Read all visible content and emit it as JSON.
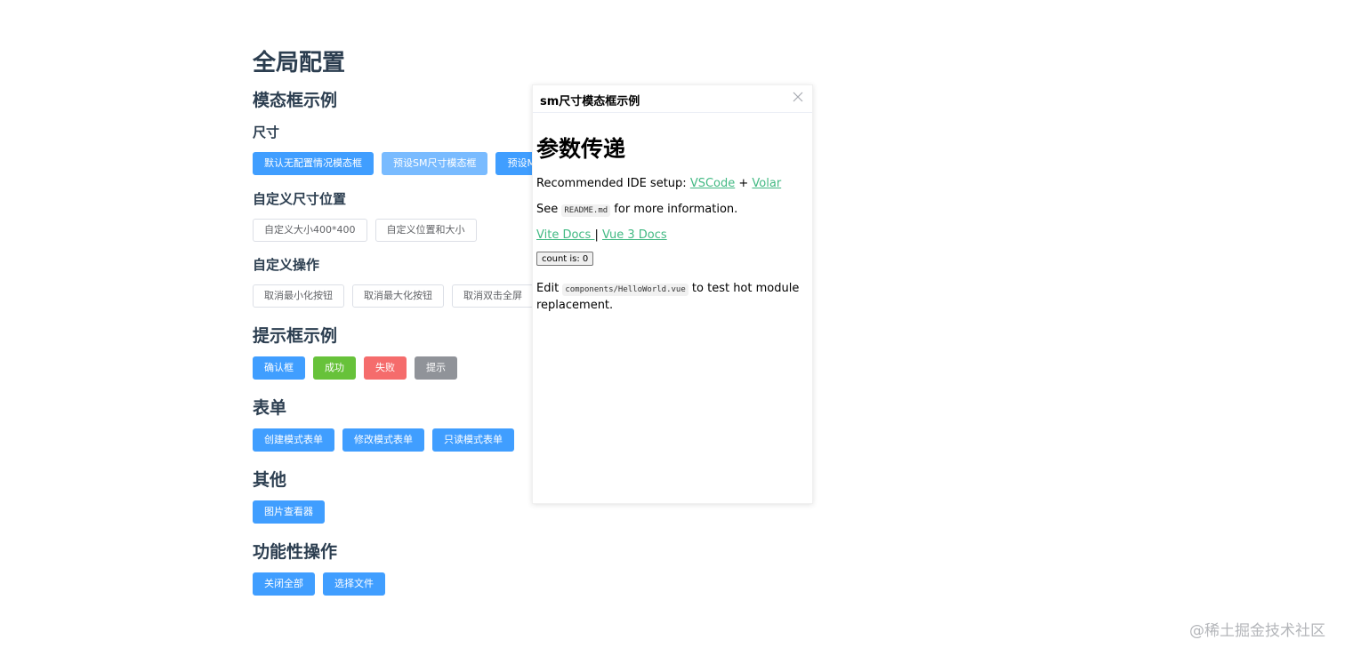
{
  "page": {
    "title": "全局配置",
    "sections": {
      "modal_examples": "模态框示例",
      "size": "尺寸",
      "custom_size_position": "自定义尺寸位置",
      "custom_operations": "自定义操作",
      "notice_examples": "提示框示例",
      "form": "表单",
      "other": "其他",
      "functional_ops": "功能性操作"
    },
    "buttons": {
      "size": [
        "默认无配置情况模态框",
        "预设SM尺寸模态框",
        "预设M"
      ],
      "custom_size": [
        "自定义大小400*400",
        "自定义位置和大小"
      ],
      "custom_ops": [
        "取消最小化按钮",
        "取消最大化按钮",
        "取消双击全屏"
      ],
      "notice": [
        "确认框",
        "成功",
        "失败",
        "提示"
      ],
      "form": [
        "创建模式表单",
        "修改模式表单",
        "只读模式表单"
      ],
      "other": [
        "图片查看器"
      ],
      "functional": [
        "关闭全部",
        "选择文件"
      ]
    }
  },
  "modal": {
    "title": "sm尺寸模态框示例",
    "close_icon": "close-icon",
    "heading": "参数传递",
    "ide_text": "Recommended IDE setup: ",
    "vscode_link": "VSCode",
    "plus": " + ",
    "volar_link": "Volar",
    "see_text": "See ",
    "readme_code": "README.md",
    "see_rest": " for more information.",
    "vite_docs_link": "Vite Docs ",
    "separator": " | ",
    "vue_docs_link": "Vue 3 Docs",
    "count_button": "count is: 0",
    "edit_text": "Edit ",
    "edit_code": "components/HelloWorld.vue",
    "edit_rest": " to test hot module replacement."
  },
  "watermark": "@稀土掘金技术社区",
  "colors": {
    "primary": "#409eff",
    "primary_light": "#79bbff",
    "success": "#67c23a",
    "danger": "#f56c6c",
    "info": "#909399",
    "link": "#42b983",
    "heading_text": "#2c3e50"
  }
}
